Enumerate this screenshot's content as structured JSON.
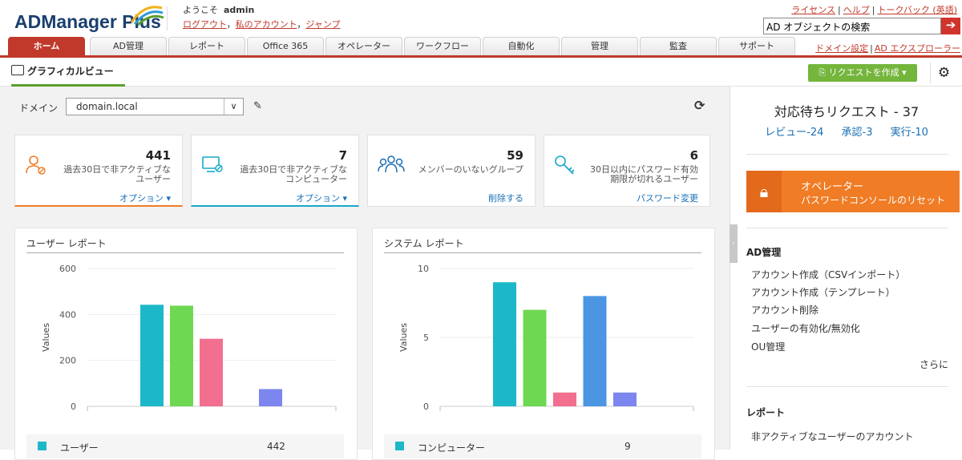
{
  "header": {
    "logo_text": "ADManager Plus",
    "welcome_prefix": "ようこそ",
    "username": "admin",
    "links": [
      "ログアウト",
      "私のアカウント",
      "ジャンプ"
    ],
    "right_links": [
      "ライセンス",
      "ヘルプ",
      "トークバック (英語)"
    ],
    "search_placeholder": "AD オブジェクトの検索",
    "search_button_icon": "arrow-right-icon"
  },
  "nav": {
    "tabs": [
      "ホーム",
      "AD管理",
      "レポート",
      "Office 365",
      "オペレーター",
      "ワークフロー",
      "自動化",
      "管理",
      "監査",
      "サポート"
    ],
    "active_tab": "ホーム",
    "right_links": [
      "ドメイン設定",
      "AD エクスプローラー"
    ]
  },
  "subbar": {
    "tab_label": "グラフィカルビュー",
    "request_button": "リクエストを作成",
    "settings_icon": "gear-icon"
  },
  "domain": {
    "label": "ドメイン",
    "value": "domain.local"
  },
  "cards": [
    {
      "number": "441",
      "desc": "過去30日で非アクティブなユーザー",
      "action": "オプション ▾",
      "icon": "inactive-user-icon",
      "color": "#f07c25"
    },
    {
      "number": "7",
      "desc": "過去30日で非アクティブなコンピューター",
      "action": "オプション ▾",
      "icon": "inactive-computer-icon",
      "color": "#17a9c9"
    },
    {
      "number": "59",
      "desc": "メンバーのいないグループ",
      "action": "削除する",
      "icon": "group-icon",
      "color": "#1a6fb5"
    },
    {
      "number": "6",
      "desc": "30日以内にパスワード有効期限が切れるユーザー",
      "action": "パスワード変更",
      "icon": "key-icon",
      "color": "#17a9c9"
    }
  ],
  "user_report": {
    "title": "ユーザー レポート",
    "legend_name": "ユーザー",
    "legend_value": "442",
    "legend_color": "#1cb8c9"
  },
  "system_report": {
    "title": "システム レポート",
    "legend_name": "コンピューター",
    "legend_value": "9",
    "legend_color": "#1cb8c9"
  },
  "chart_data": [
    {
      "type": "bar",
      "ylabel": "Values",
      "ylim": [
        0,
        600
      ],
      "yticks": [
        0,
        200,
        400,
        600
      ],
      "values": [
        442,
        438,
        294,
        75
      ],
      "colors": [
        "#1cb8c9",
        "#6fd852",
        "#f26f90",
        "#7c86ee"
      ]
    },
    {
      "type": "bar",
      "ylabel": "Values",
      "ylim": [
        0,
        10
      ],
      "yticks": [
        0,
        5,
        10
      ],
      "values": [
        9,
        7,
        1,
        8,
        1
      ],
      "colors": [
        "#1cb8c9",
        "#6fd852",
        "#f26f90",
        "#4b95e2",
        "#7c86ee"
      ]
    }
  ],
  "sidebar": {
    "pending_title": "対応待ちリクエスト - 37",
    "pending_links": [
      "レビュー-24",
      "承認-3",
      "実行-10"
    ],
    "operator_title": "オペレーター",
    "operator_sub": "パスワードコンソールのリセット",
    "ad_section": "AD管理",
    "ad_items": [
      "アカウント作成（CSVインポート）",
      "アカウント作成（テンプレート）",
      "アカウント削除",
      "ユーザーの有効化/無効化",
      "OU管理"
    ],
    "more": "さらに",
    "report_section": "レポート",
    "report_items": [
      "非アクティブなユーザーのアカウント"
    ]
  }
}
